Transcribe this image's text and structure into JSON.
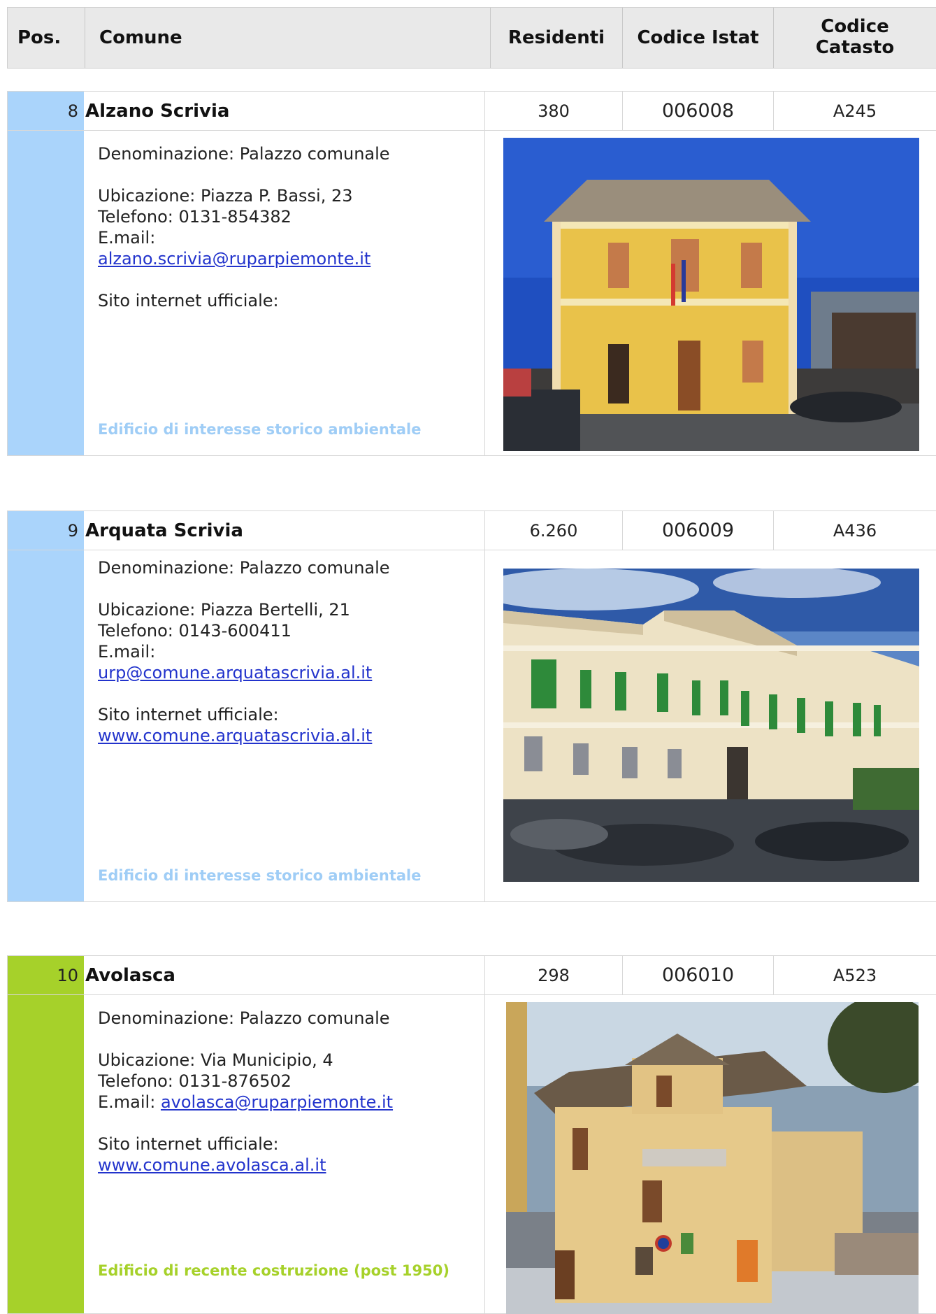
{
  "header": {
    "pos": "Pos.",
    "comune": "Comune",
    "residenti": "Residenti",
    "istat": "Codice Istat",
    "catasto_line1": "Codice",
    "catasto_line2": "Catasto"
  },
  "records": [
    {
      "pos": "8",
      "name": "Alzano Scrivia",
      "residenti": "380",
      "istat": "006008",
      "catasto": "A245",
      "denominazione": "Denominazione: Palazzo comunale",
      "ubicazione": "Ubicazione: Piazza P. Bassi, 23",
      "telefono": "Telefono: 0131-854382",
      "email_label": "E.mail:",
      "email": "alzano.scrivia@ruparpiemonte.it",
      "sito_label": "Sito internet ufficiale:",
      "sito": "",
      "category": "Edificio di interesse storico ambientale",
      "category_color": "#9fcdf6"
    },
    {
      "pos": "9",
      "name": "Arquata Scrivia",
      "residenti": "6.260",
      "istat": "006009",
      "catasto": "A436",
      "denominazione": "Denominazione: Palazzo comunale",
      "ubicazione": "Ubicazione: Piazza Bertelli, 21",
      "telefono": "Telefono: 0143-600411",
      "email_label": "E.mail:",
      "email": "urp@comune.arquatascrivia.al.it",
      "sito_label": "Sito internet ufficiale:",
      "sito": "www.comune.arquatascrivia.al.it",
      "category": "Edificio di interesse storico ambientale",
      "category_color": "#9fcdf6"
    },
    {
      "pos": "10",
      "name": "Avolasca",
      "residenti": "298",
      "istat": "006010",
      "catasto": "A523",
      "denominazione": "Denominazione: Palazzo comunale",
      "ubicazione": "Ubicazione: Via Municipio, 4",
      "telefono": "Telefono: 0131-876502",
      "email_label": "E.mail:",
      "email": "avolasca@ruparpiemonte.it",
      "sito_label": "Sito internet ufficiale:",
      "sito": "www.comune.avolasca.al.it",
      "category": "Edificio di recente costruzione (post 1950)",
      "category_color": "#a6d12a"
    }
  ]
}
